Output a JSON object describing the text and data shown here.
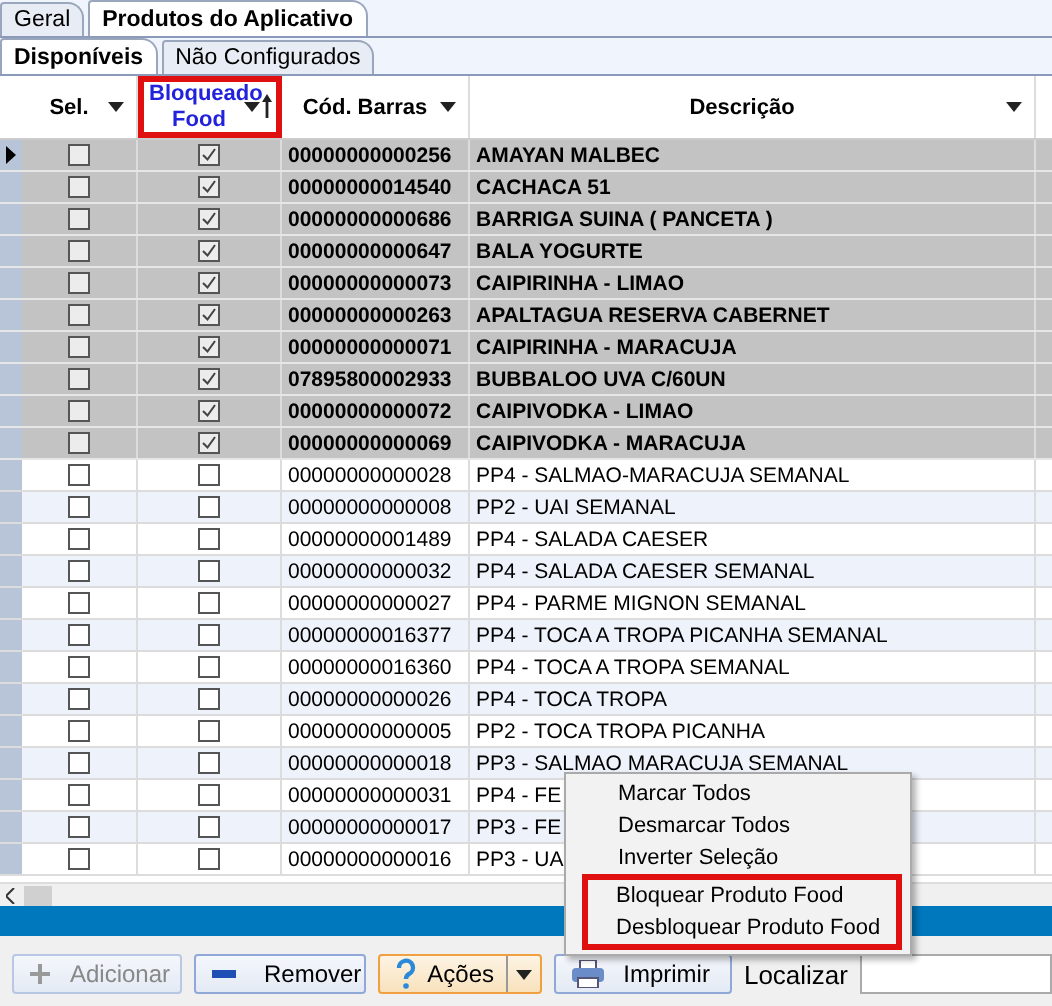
{
  "tabs": [
    {
      "label": "Geral",
      "selected": false
    },
    {
      "label": "Produtos do Aplicativo",
      "selected": true
    }
  ],
  "subtabs": [
    {
      "label": "Disponíveis",
      "selected": true
    },
    {
      "label": "Não Configurados",
      "selected": false
    }
  ],
  "columns": [
    {
      "label": "Sel.",
      "highlighted": false,
      "sorted": false
    },
    {
      "label": "Bloqueado Food",
      "highlighted": true,
      "sorted": true
    },
    {
      "label": "Cód. Barras",
      "highlighted": false,
      "sorted": false
    },
    {
      "label": "Descrição",
      "highlighted": false,
      "sorted": false
    }
  ],
  "rows": [
    {
      "current": true,
      "sel": false,
      "blocked": true,
      "barcode": "00000000000256",
      "description": "AMAYAN MALBEC"
    },
    {
      "current": false,
      "sel": false,
      "blocked": true,
      "barcode": "00000000014540",
      "description": "CACHACA 51"
    },
    {
      "current": false,
      "sel": false,
      "blocked": true,
      "barcode": "00000000000686",
      "description": "BARRIGA SUINA ( PANCETA )"
    },
    {
      "current": false,
      "sel": false,
      "blocked": true,
      "barcode": "00000000000647",
      "description": "BALA YOGURTE"
    },
    {
      "current": false,
      "sel": false,
      "blocked": true,
      "barcode": "00000000000073",
      "description": "CAIPIRINHA - LIMAO"
    },
    {
      "current": false,
      "sel": false,
      "blocked": true,
      "barcode": "00000000000263",
      "description": "APALTAGUA RESERVA CABERNET"
    },
    {
      "current": false,
      "sel": false,
      "blocked": true,
      "barcode": "00000000000071",
      "description": "CAIPIRINHA - MARACUJA"
    },
    {
      "current": false,
      "sel": false,
      "blocked": true,
      "barcode": "07895800002933",
      "description": "BUBBALOO UVA C/60UN"
    },
    {
      "current": false,
      "sel": false,
      "blocked": true,
      "barcode": "00000000000072",
      "description": "CAIPIVODKA - LIMAO"
    },
    {
      "current": false,
      "sel": false,
      "blocked": true,
      "barcode": "00000000000069",
      "description": "CAIPIVODKA - MARACUJA"
    },
    {
      "current": false,
      "sel": false,
      "blocked": false,
      "barcode": "00000000000028",
      "description": "PP4 - SALMAO-MARACUJA SEMANAL"
    },
    {
      "current": false,
      "sel": false,
      "blocked": false,
      "barcode": "00000000000008",
      "description": "PP2 - UAI SEMANAL"
    },
    {
      "current": false,
      "sel": false,
      "blocked": false,
      "barcode": "00000000001489",
      "description": "PP4 - SALADA CAESER"
    },
    {
      "current": false,
      "sel": false,
      "blocked": false,
      "barcode": "00000000000032",
      "description": "PP4 - SALADA CAESER SEMANAL"
    },
    {
      "current": false,
      "sel": false,
      "blocked": false,
      "barcode": "00000000000027",
      "description": "PP4 - PARME MIGNON SEMANAL"
    },
    {
      "current": false,
      "sel": false,
      "blocked": false,
      "barcode": "00000000016377",
      "description": "PP4 - TOCA A TROPA PICANHA SEMANAL"
    },
    {
      "current": false,
      "sel": false,
      "blocked": false,
      "barcode": "00000000016360",
      "description": "PP4 - TOCA A TROPA SEMANAL"
    },
    {
      "current": false,
      "sel": false,
      "blocked": false,
      "barcode": "00000000000026",
      "description": "PP4 - TOCA TROPA"
    },
    {
      "current": false,
      "sel": false,
      "blocked": false,
      "barcode": "00000000000005",
      "description": "PP2 - TOCA TROPA PICANHA"
    },
    {
      "current": false,
      "sel": false,
      "blocked": false,
      "barcode": "00000000000018",
      "description": "PP3 - SALMAO MARACUJA SEMANAL"
    },
    {
      "current": false,
      "sel": false,
      "blocked": false,
      "barcode": "00000000000031",
      "description": "PP4 - FE"
    },
    {
      "current": false,
      "sel": false,
      "blocked": false,
      "barcode": "00000000000017",
      "description": "PP3 - FE"
    },
    {
      "current": false,
      "sel": false,
      "blocked": false,
      "barcode": "00000000000016",
      "description": "PP3 - UA"
    }
  ],
  "context_menu": [
    {
      "label": "Marcar Todos",
      "highlighted": false
    },
    {
      "label": "Desmarcar Todos",
      "highlighted": false
    },
    {
      "label": "Inverter Seleção",
      "highlighted": false
    },
    {
      "label": "Bloquear Produto Food",
      "highlighted": true
    },
    {
      "label": "Desbloquear Produto Food",
      "highlighted": true
    }
  ],
  "toolbar": [
    {
      "kind": "add",
      "label": "Adicionar",
      "disabled": true
    },
    {
      "kind": "remove",
      "label": "Remover",
      "disabled": false
    },
    {
      "kind": "actions",
      "label": "Ações",
      "disabled": false
    },
    {
      "kind": "print",
      "label": "Imprimir",
      "disabled": false
    }
  ],
  "search": {
    "label": "Localizar"
  }
}
